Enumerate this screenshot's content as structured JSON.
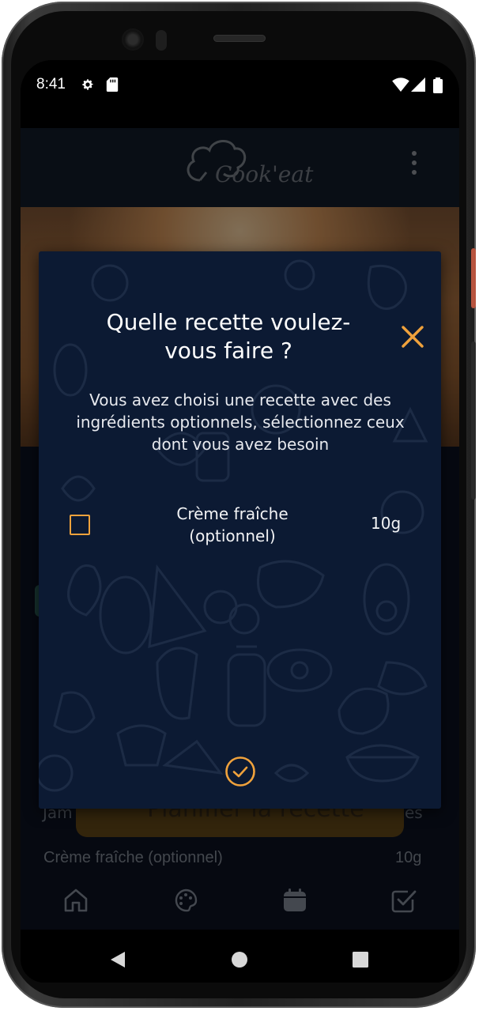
{
  "status_bar": {
    "time": "8:41"
  },
  "app": {
    "logo_text": "Cook'eat"
  },
  "background_page": {
    "plan_button_label": "Planifier la recette",
    "ingredient_row_left": "Jam",
    "ingredient_row_right": "es",
    "ingredient_name": "Crème fraîche (optionnel)",
    "ingredient_qty": "10g"
  },
  "dialog": {
    "title": "Quelle recette voulez-vous faire ?",
    "subtitle": "Vous avez choisi une recette avec des ingrédients optionnels, sélectionnez ceux dont vous avez besoin",
    "options": [
      {
        "label": "Crème fraîche (optionnel)",
        "quantity": "10g",
        "checked": false
      }
    ],
    "close_icon": "close-icon",
    "confirm_icon": "check-circle-icon"
  },
  "bottom_nav": {
    "items": [
      "home-icon",
      "palette-icon",
      "calendar-icon",
      "checklist-icon"
    ]
  },
  "colors": {
    "accent": "#f0a23c",
    "dialog_bg": "#0c1a33",
    "page_bg": "#0b1220"
  }
}
